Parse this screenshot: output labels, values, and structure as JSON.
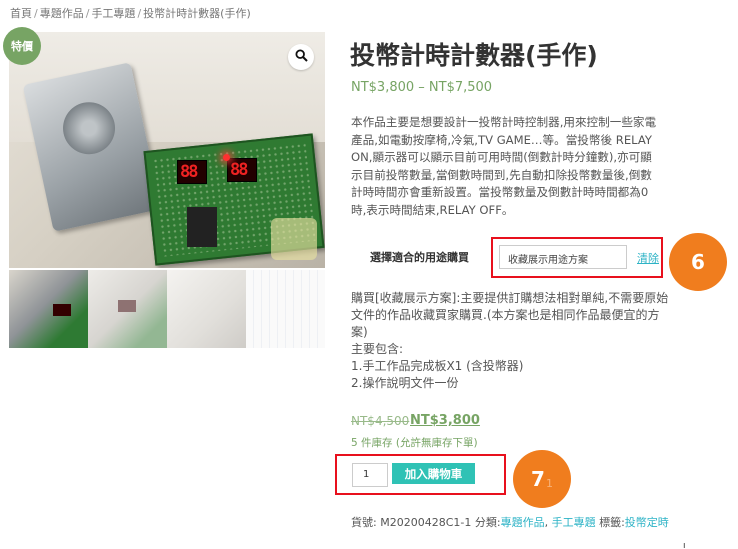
{
  "breadcrumb": {
    "home": "首頁",
    "cat1": "專題作品",
    "cat2": "手工專題",
    "current": "投幣計時計數器(手作)",
    "sep": "/"
  },
  "gallery": {
    "sale_badge": "特價",
    "zoom_icon": "magnifier-icon",
    "thumb_count": 4
  },
  "product": {
    "title": "投幣計時計數器(手作)",
    "price_range": "NT$3,800 – NT$7,500",
    "description": "本作品主要是想要設計一投幣計時控制器,用來控制一些家電產品,如電動按摩椅,冷氣,TV GAME…等。當投幣後 RELAY ON,顯示器可以顯示目前可用時間(倒數計時分鐘數),亦可顯示目前投幣數量,當倒數時間到,先自動扣除投幣數量後,倒數計時時間亦會重新設置。當投幣數量及倒數計時時間都為0時,表示時間結束,RELAY OFF。"
  },
  "variation": {
    "label": "選擇適合的用途購買",
    "selected": "收藏展示用途方案",
    "clear": "清除"
  },
  "variation_description": {
    "lines": [
      "購買[收藏展示方案]:主要提供訂購想法相對單純,不需要原始",
      "文件的作品收藏買家購買.(本方案也是相同作品最便宜的方",
      "案)",
      "主要包含:",
      "1.手工作品完成板X1 (含投幣器)",
      "2.操作說明文件一份"
    ]
  },
  "pricing": {
    "old": "NT$4,500",
    "new": "NT$3,800",
    "stock": "5 件庫存 (允許無庫存下單)"
  },
  "cart": {
    "quantity": "1",
    "add_button": "加入購物車"
  },
  "meta": {
    "sku_label": "貨號:",
    "sku": "M20200428C1-1",
    "cat_label": "分類:",
    "cat1": "專題作品",
    "cat_sep": ", ",
    "cat2": "手工專題",
    "tag_label": "標籤:",
    "tag": "投幣定時"
  },
  "annotations": {
    "six": "6",
    "seven": "7",
    "seven_sub": "1"
  },
  "colors": {
    "accent_green": "#77a464",
    "teal": "#2fc2b5",
    "annotation_red": "#e8101d",
    "annotation_orange": "#f07d1e"
  }
}
